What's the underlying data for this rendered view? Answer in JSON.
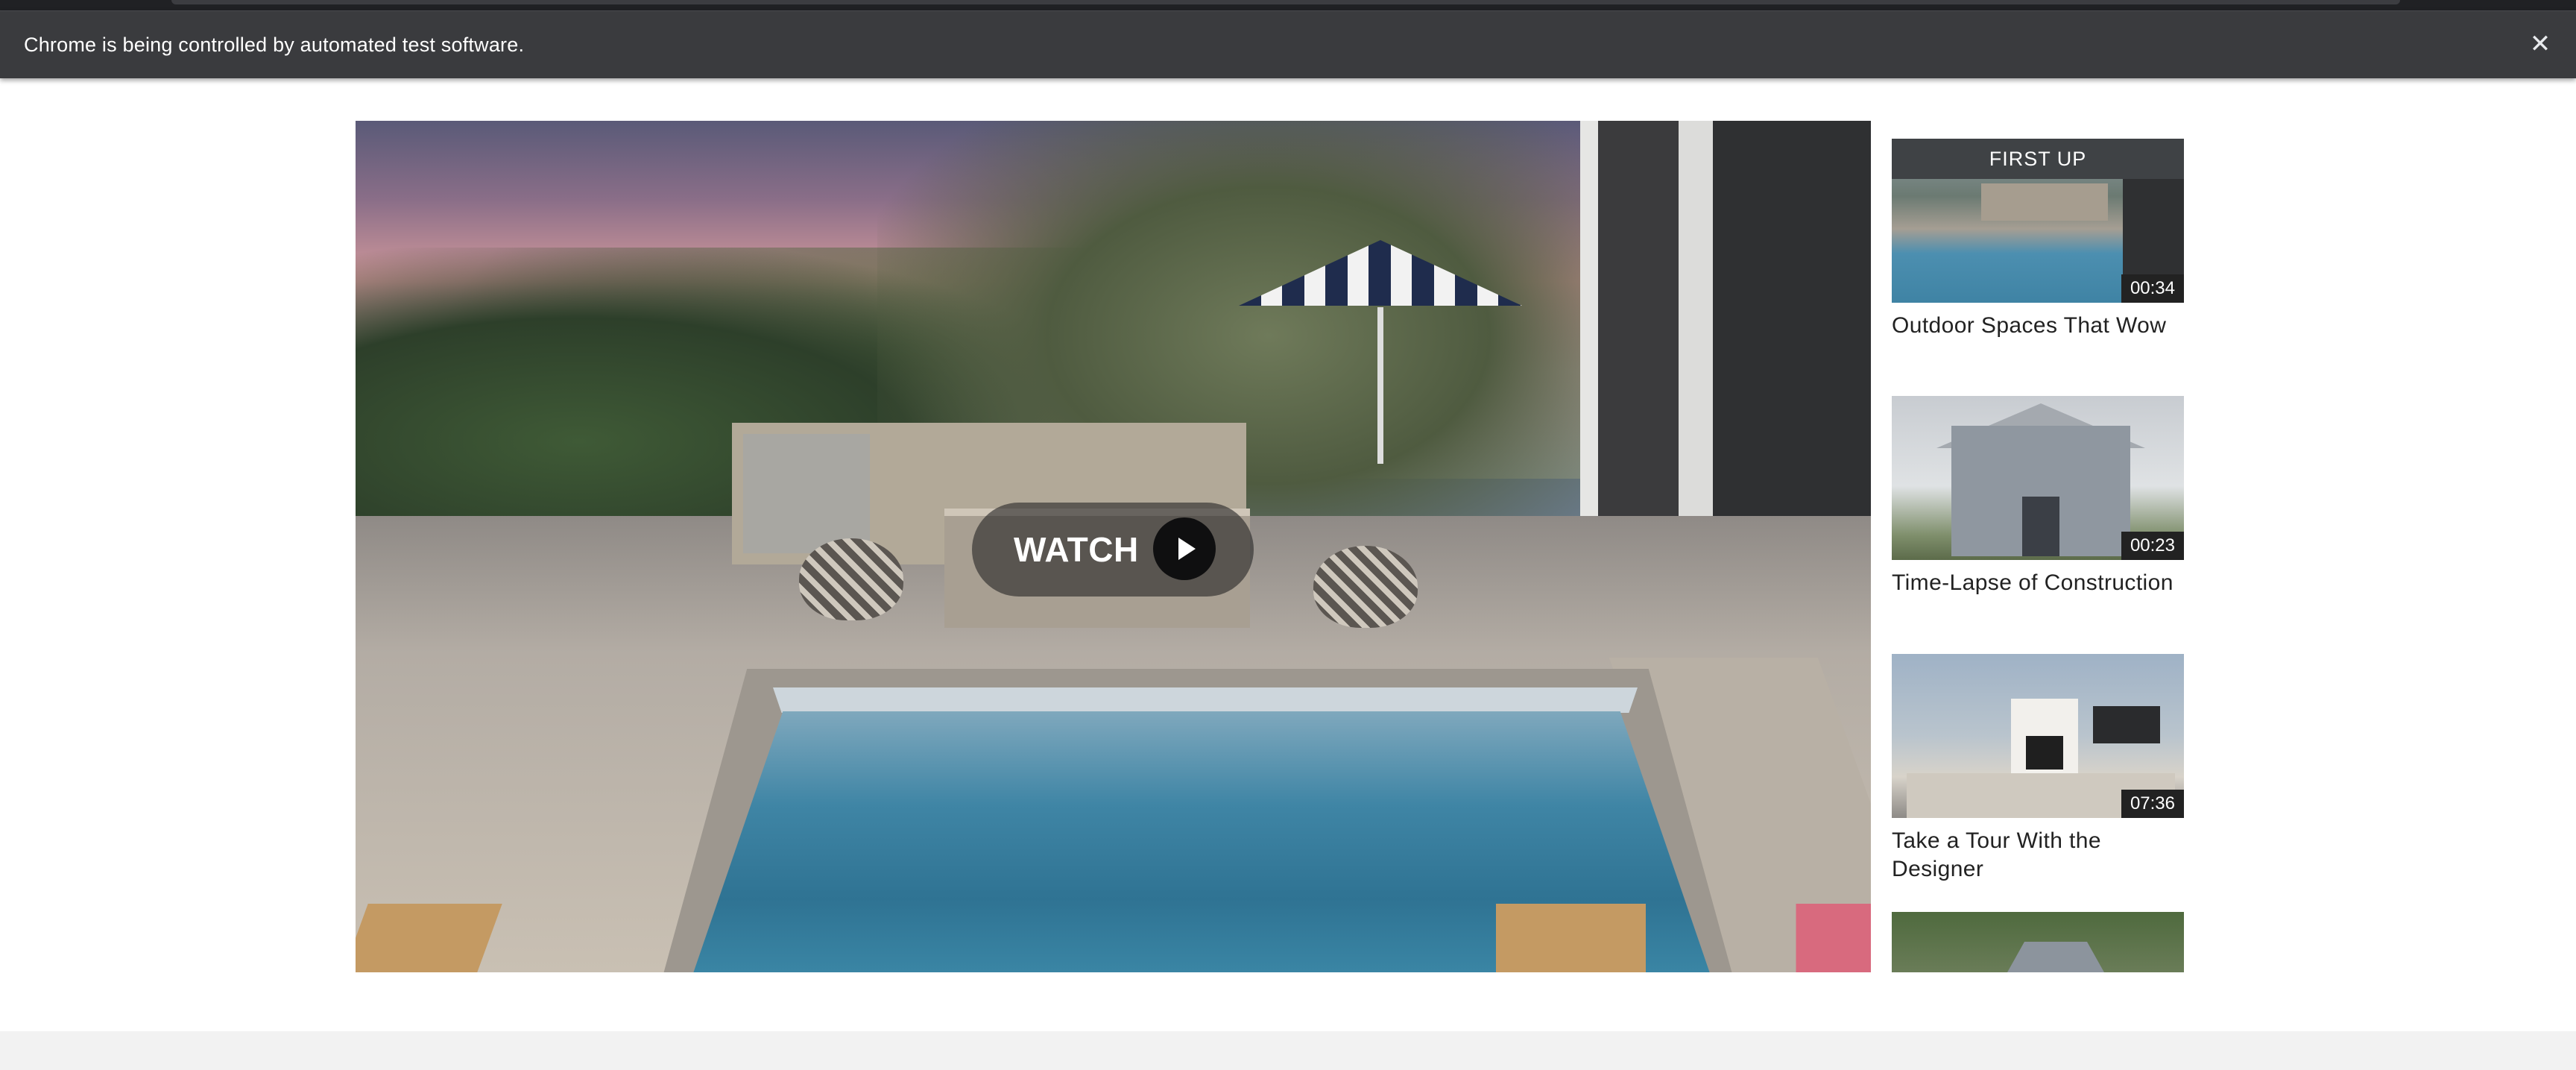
{
  "browser": {
    "infobar_text": "Chrome is being controlled by automated test software.",
    "close_glyph": "✕"
  },
  "hero": {
    "watch_label": "WATCH",
    "play_icon": "play-icon"
  },
  "playlist": {
    "items": [
      {
        "badge": "FIRST UP",
        "title": "Outdoor Spaces That Wow",
        "duration": "00:34",
        "scene": "pool"
      },
      {
        "badge": "",
        "title": "Time-Lapse of Construction",
        "duration": "00:23",
        "scene": "house-exterior"
      },
      {
        "badge": "",
        "title": "Take a Tour With the Designer",
        "duration": "07:36",
        "scene": "living-room"
      },
      {
        "badge": "",
        "title": "",
        "duration": "",
        "scene": "aerial-house"
      }
    ]
  },
  "colors": {
    "infobar_bg": "#3a3b3e",
    "badge_bg": "#3f4245",
    "duration_bg": "#222222",
    "title_text": "#222222"
  }
}
